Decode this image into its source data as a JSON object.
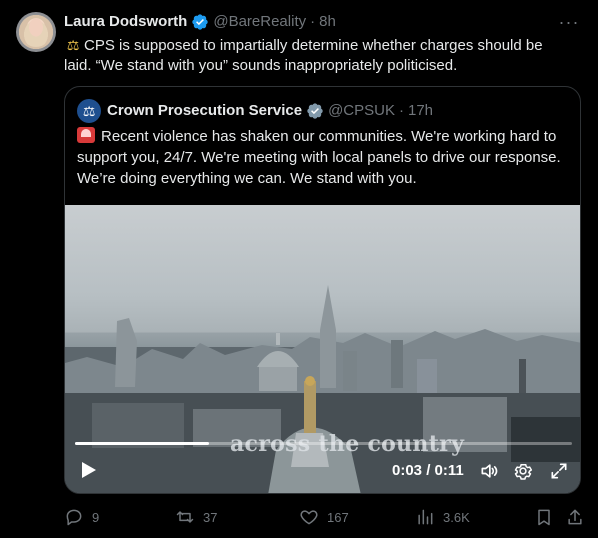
{
  "author": {
    "name": "Laura Dodsworth",
    "handle": "@BareReality",
    "time": "8h",
    "more": "···"
  },
  "tweet_text": "CPS is supposed to impartially determine whether charges should be laid. “We stand with you” sounds inappropriately politicised.",
  "quoted": {
    "name": "Crown Prosecution Service",
    "handle": "@CPSUK",
    "time": "17h",
    "text": "Recent violence has shaken our communities. We're working hard to support you, 24/7. We're meeting with local panels to drive our response. We’re doing everything we can. We stand with you.",
    "video": {
      "caption": "across the country",
      "time": "0:03 / 0:11",
      "progress": 0.27
    }
  },
  "actions": {
    "replies": "9",
    "reposts": "37",
    "likes": "167",
    "views": "3.6K"
  },
  "colors": {
    "background": "#000000",
    "text": "#e7e9ea",
    "muted": "#71767b",
    "verified": "#1d9bf0"
  }
}
